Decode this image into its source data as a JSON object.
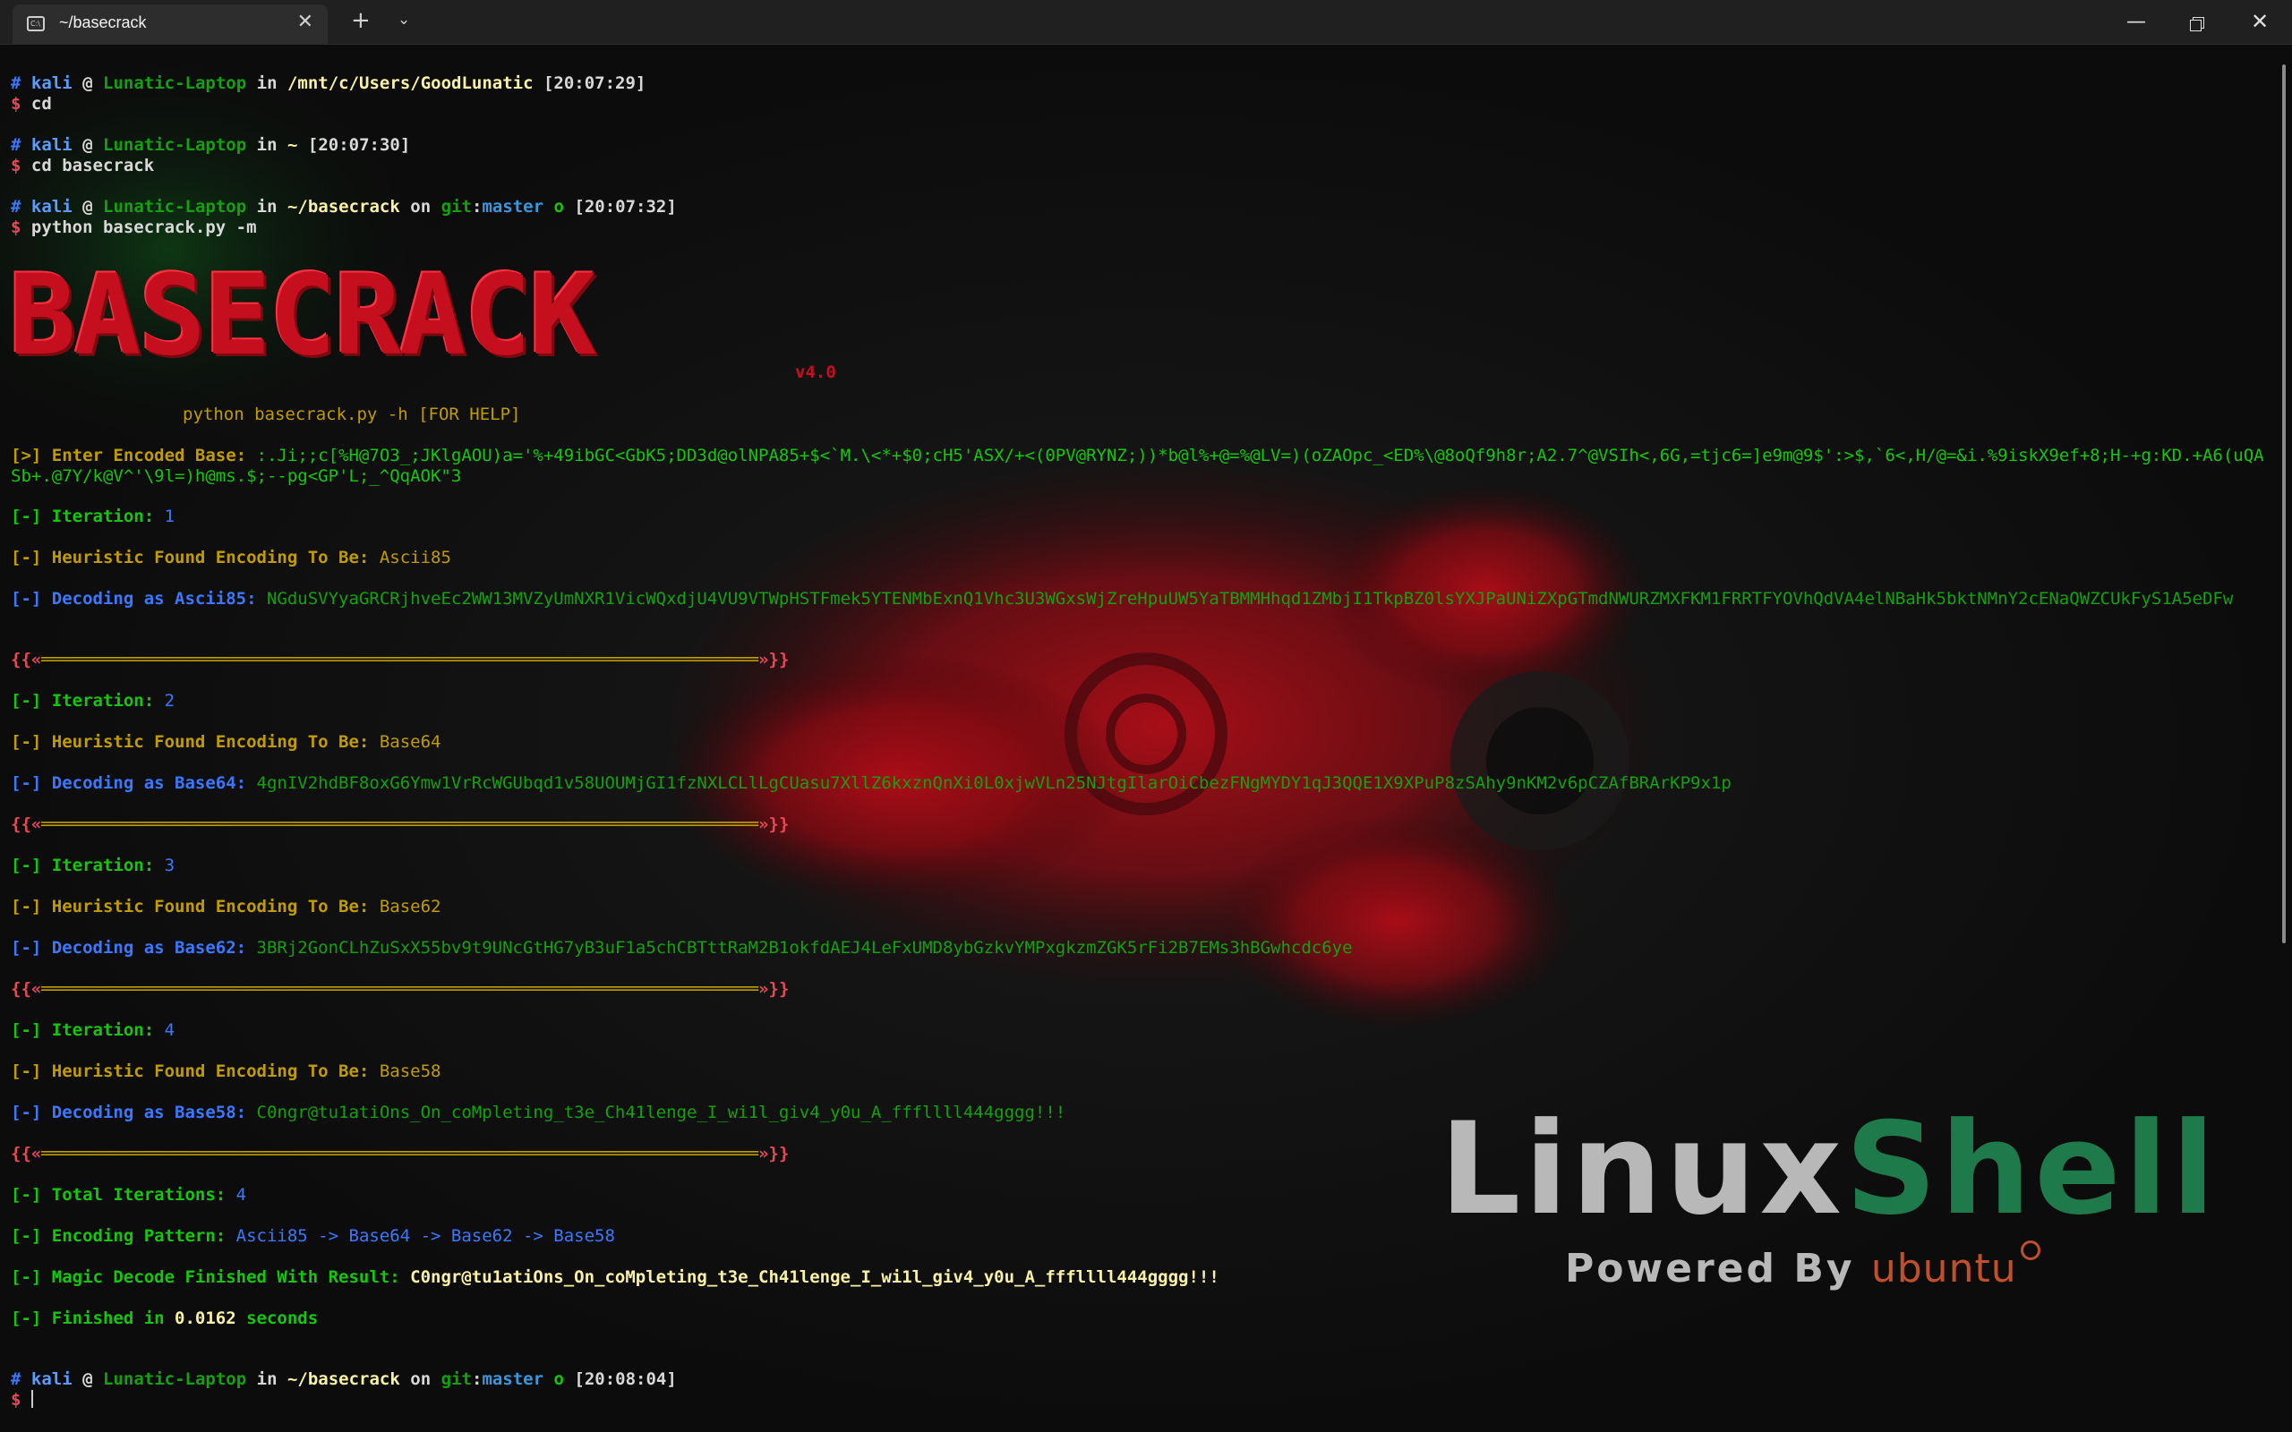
{
  "window": {
    "tab_title": "~/basecrack",
    "tab_icon": "terminal-icon",
    "close_tab": "✕",
    "new_tab": "+",
    "tab_dropdown": "⌄",
    "minimize": "—",
    "close": "✕"
  },
  "prompts": [
    {
      "hash": "#",
      "user": "kali",
      "at": "@",
      "host": "Lunatic-Laptop",
      "in": "in",
      "path": "/mnt/c/Users/GoodLunatic",
      "on": "",
      "git": "",
      "git_sep": "",
      "branch": "",
      "state": "",
      "time": "[20:07:29]",
      "cmd": "cd"
    },
    {
      "hash": "#",
      "user": "kali",
      "at": "@",
      "host": "Lunatic-Laptop",
      "in": "in",
      "path": "~",
      "on": "",
      "git": "",
      "git_sep": "",
      "branch": "",
      "state": "",
      "time": "[20:07:30]",
      "cmd": "cd basecrack"
    },
    {
      "hash": "#",
      "user": "kali",
      "at": "@",
      "host": "Lunatic-Laptop",
      "in": "in",
      "path": "~/basecrack",
      "on": "on",
      "git": "git",
      "git_sep": ":",
      "branch": "master",
      "state": "o",
      "time": "[20:07:32]",
      "cmd": "python basecrack.py -m"
    },
    {
      "hash": "#",
      "user": "kali",
      "at": "@",
      "host": "Lunatic-Laptop",
      "in": "in",
      "path": "~/basecrack",
      "on": "on",
      "git": "git",
      "git_sep": ":",
      "branch": "master",
      "state": "o",
      "time": "[20:08:04]",
      "cmd": ""
    }
  ],
  "dollar": "$",
  "banner": {
    "title": "BASECRACK",
    "version": "v4.0",
    "help": "python basecrack.py -h [FOR HELP]"
  },
  "input": {
    "label": "[>] Enter Encoded Base: ",
    "value": ":.Ji;;c[%H@7O3_;JKlgAOU)a='%+49ibGC<GbK5;DD3d@olNPA85+$<`M.\\<*+$0;cH5'ASX/+<(0PV@RYNZ;))*b@l%+@=%@LV=)(oZAOpc_<ED%\\@8oQf9h8r;A2.7^@VSIh<,6G,=tjc6=]e9m@9$':>$,`6<,H/@=&i.%9iskX9ef+8;H-+g:KD.+A6(uQASb+.@7Y/k@V^'\\9l=)h@ms.$;--pg<GP'L;_^QqAOK\"3"
  },
  "iterations": [
    {
      "iter_label": "[-] Iteration: ",
      "iter_num": "1",
      "heur_label": "[-] Heuristic Found Encoding To Be: ",
      "encoding": "Ascii85",
      "dec_label": "[-] Decoding as Ascii85: ",
      "decoded": "NGduSVYyaGRCRjhveEc2WW13MVZyUmNXR1VicWQxdjU4VU9VTWpHSTFmek5YTENMbExnQ1Vhc3U3WGxsWjZreHpuUW5YaTBMMHhqd1ZMbjI1TkpBZ0lsYXJPaUNiZXpGTmdNWURZMXFKM1FRRTFYOVhQdVA4elNBaHk5bktNMnY2cENaQWZCUkFyS1A5eDFw"
    },
    {
      "iter_label": "[-] Iteration: ",
      "iter_num": "2",
      "heur_label": "[-] Heuristic Found Encoding To Be: ",
      "encoding": "Base64",
      "dec_label": "[-] Decoding as Base64: ",
      "decoded": "4gnIV2hdBF8oxG6Ymw1VrRcWGUbqd1v58UOUMjGI1fzNXLCLlLgCUasu7XllZ6kxznQnXi0L0xjwVLn25NJtgIlarOiCbezFNgMYDY1qJ3QQE1X9XPuP8zSAhy9nKM2v6pCZAfBRArKP9x1p"
    },
    {
      "iter_label": "[-] Iteration: ",
      "iter_num": "3",
      "heur_label": "[-] Heuristic Found Encoding To Be: ",
      "encoding": "Base62",
      "dec_label": "[-] Decoding as Base62: ",
      "decoded": "3BRj2GonCLhZuSxX55bv9t9UNcGtHG7yB3uF1a5chCBTttRaM2B1okfdAEJ4LeFxUMD8ybGzkvYMPxgkzmZGK5rFi2B7EMs3hBGwhcdc6ye"
    },
    {
      "iter_label": "[-] Iteration: ",
      "iter_num": "4",
      "heur_label": "[-] Heuristic Found Encoding To Be: ",
      "encoding": "Base58",
      "dec_label": "[-] Decoding as Base58: ",
      "decoded": "C0ngr@tu1atiOns_On_coMpleting_t3e_Ch41lenge_I_wi1l_giv4_y0u_A_fffllll444gggg!!!"
    }
  ],
  "separator": {
    "left": "{{«",
    "bar": "══════════════════════════════════════════════════════════════════════",
    "right": "»}}"
  },
  "summary": {
    "total_label": "[-] Total Iterations: ",
    "total_value": "4",
    "pattern_label": "[-] Encoding Pattern: ",
    "pattern_value": "Ascii85 -> Base64 -> Base62 -> Base58",
    "magic_label": "[-] Magic Decode Finished With Result: ",
    "magic_value": "C0ngr@tu1atiOns_On_coMpleting_t3e_Ch41lenge_I_wi1l_giv4_y0u_A_fffllll444gggg!!!",
    "finished_label": "[-] Finished in ",
    "finished_value": "0.0162",
    "finished_unit": " seconds"
  },
  "wallpaper": {
    "logo_linux": "Linux",
    "logo_shell": "Shell",
    "powered_by": "Powered By ",
    "ubuntu": "ubuntu",
    "accent_red": "#c50f1f",
    "accent_green": "#1e7a4a"
  }
}
